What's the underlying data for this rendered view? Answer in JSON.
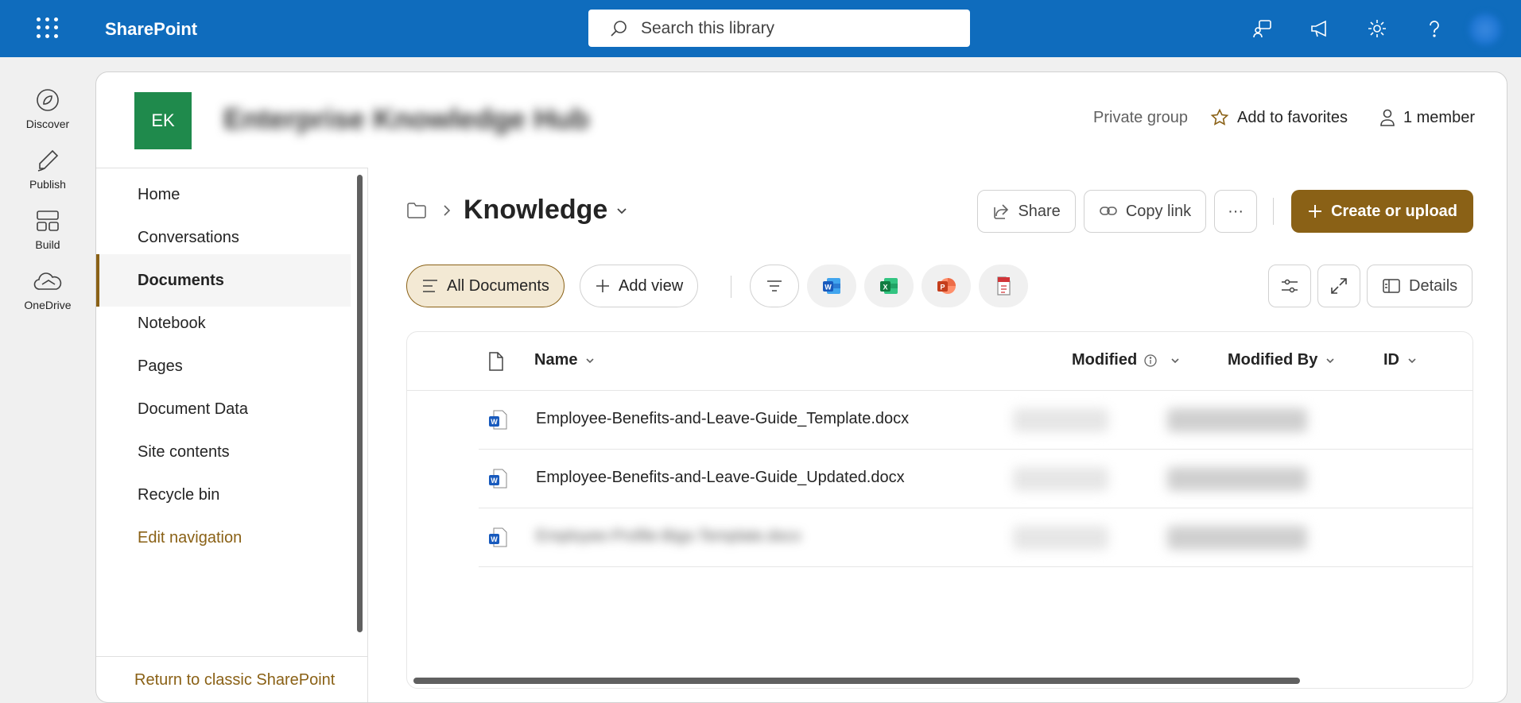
{
  "suite": {
    "app_name": "SharePoint",
    "search_placeholder": "Search this library",
    "icons": [
      "waffle-icon",
      "search-icon",
      "feedback-icon",
      "announcement-icon",
      "settings-icon",
      "help-icon"
    ]
  },
  "appbar": [
    {
      "label": "Discover",
      "icon": "compass-icon"
    },
    {
      "label": "Publish",
      "icon": "pen-icon"
    },
    {
      "label": "Build",
      "icon": "layout-icon"
    },
    {
      "label": "OneDrive",
      "icon": "cloud-icon"
    }
  ],
  "site": {
    "logo_initials": "EK",
    "title": "Enterprise Knowledge Hub",
    "privacy": "Private group",
    "favorite_label": "Add to favorites",
    "members_label": "1 member"
  },
  "nav": {
    "items": [
      {
        "label": "Home"
      },
      {
        "label": "Conversations"
      },
      {
        "label": "Documents",
        "active": true
      },
      {
        "label": "Notebook"
      },
      {
        "label": "Pages"
      },
      {
        "label": "Document Data"
      },
      {
        "label": "Site contents"
      },
      {
        "label": "Recycle bin"
      }
    ],
    "edit_label": "Edit navigation",
    "classic_label": "Return to classic SharePoint"
  },
  "library": {
    "name": "Knowledge",
    "share_label": "Share",
    "copy_link_label": "Copy link",
    "more_label": "···",
    "create_label": "Create or upload",
    "view_label": "All Documents",
    "add_view_label": "Add view",
    "details_label": "Details"
  },
  "table": {
    "columns": {
      "name": "Name",
      "modified": "Modified",
      "modified_by": "Modified By",
      "id": "ID"
    },
    "rows": [
      {
        "name": "Employee-Benefits-and-Leave-Guide_Template.docx"
      },
      {
        "name": "Employee-Benefits-and-Leave-Guide_Updated.docx"
      },
      {
        "name": "Employee-Profile-Bigs-Template.docx"
      }
    ]
  },
  "colors": {
    "suite_blue": "#0f6cbd",
    "accent_gold": "#8a6116",
    "logo_green": "#1f8a4c"
  }
}
